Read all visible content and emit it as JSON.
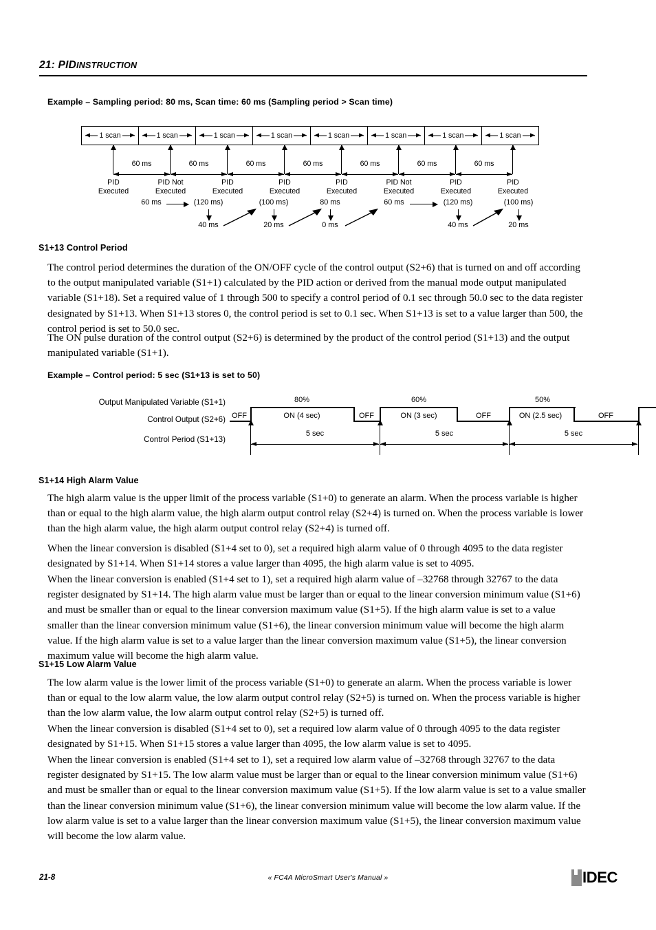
{
  "header": {
    "chapter_number": "21:",
    "chapter_title_first": "PID",
    "chapter_title_rest": "INSTRUCTION"
  },
  "example1": {
    "heading": "Example – Sampling period: 80 ms, Scan time: 60 ms (Sampling period > Scan time)",
    "scan_label": "1 scan",
    "scan_count": 8,
    "interval_label": "60 ms",
    "interval_count": 7,
    "pid_labels": [
      "PID\nExecuted",
      "PID Not\nExecuted",
      "PID\nExecuted",
      "PID\nExecuted",
      "PID\nExecuted",
      "PID Not\nExecuted",
      "PID\nExecuted",
      "PID\nExecuted"
    ],
    "flow": [
      {
        "top": "60 ms",
        "bottom": ""
      },
      {
        "top": "(120 ms)",
        "bottom": "40 ms"
      },
      {
        "top": "(100 ms)",
        "bottom": "20 ms"
      },
      {
        "top": "80 ms",
        "bottom": "0 ms"
      },
      {
        "top": "60 ms",
        "bottom": ""
      },
      {
        "top": "(120 ms)",
        "bottom": "40 ms"
      },
      {
        "top": "(100 ms)",
        "bottom": "20 ms"
      }
    ]
  },
  "s1_13": {
    "heading": "S1+13  Control Period",
    "p1": "The control period determines the duration of the ON/OFF cycle of the control output (S2+6) that is turned on and off according to the output manipulated variable (S1+1) calculated by the PID action or derived from the manual mode output manipulated variable (S1+18). Set a required value of 1 through 500 to specify a control period of 0.1 sec through 50.0 sec to the data register designated by S1+13. When S1+13 stores 0, the control period is set to 0.1 sec. When S1+13 is set to a value larger than 500, the control period is set to 50.0 sec.",
    "p2": "The ON pulse duration of the control output (S2+6) is determined by the product of the control period (S1+13) and the output manipulated variable (S1+1)."
  },
  "example2": {
    "heading": "Example – Control period: 5 sec (S1+13 is set to 50)",
    "row_labels": [
      "Output Manipulated Variable (S1+1)",
      "Control Output (S2+6)",
      "Control Period (S1+13)"
    ],
    "off_label": "OFF",
    "period_label": "5 sec",
    "cycles": [
      {
        "percent": "80%",
        "on_label": "ON (4 sec)",
        "period": "5 sec"
      },
      {
        "percent": "60%",
        "on_label": "ON (3 sec)",
        "period": "5 sec"
      },
      {
        "percent": "50%",
        "on_label": "ON (2.5 sec)",
        "period": "5 sec"
      }
    ]
  },
  "s1_14": {
    "heading": "S1+14  High Alarm Value",
    "p1": "The high alarm value is the upper limit of the process variable (S1+0) to generate an alarm. When the process variable is higher than or equal to the high alarm value, the high alarm output control relay (S2+4) is turned on. When the process variable is lower than the high alarm value, the high alarm output control relay (S2+4) is turned off.",
    "p2": "When the linear conversion is disabled (S1+4 set to 0), set a required high alarm value of 0 through 4095 to the data register designated by S1+14. When S1+14 stores a value larger than 4095, the high alarm value is set to 4095.",
    "p3": "When the linear conversion is enabled (S1+4 set to 1), set a required high alarm value of –32768 through 32767 to the data register designated by S1+14. The high alarm value must be larger than or equal to the linear conversion minimum value (S1+6) and must be smaller than or equal to the linear conversion maximum value (S1+5). If the high alarm value is set to a value smaller than the linear conversion minimum value (S1+6), the linear conversion minimum value will become the high alarm value. If the high alarm value is set to a value larger than the linear conversion maximum value (S1+5), the linear conversion maximum value will become the high alarm value."
  },
  "s1_15": {
    "heading": "S1+15  Low Alarm Value",
    "p1": "The low alarm value is the lower limit of the process variable (S1+0) to generate an alarm. When the process variable is lower than or equal to the low alarm value, the low alarm output control relay (S2+5) is turned on. When the process variable is higher than the low alarm value, the low alarm output control relay (S2+5) is turned off.",
    "p2": "When the linear conversion is disabled (S1+4 set to 0), set a required low alarm value of 0 through 4095 to the data register designated by S1+15. When S1+15 stores a value larger than 4095, the low alarm value is set to 4095.",
    "p3": "When the linear conversion is enabled (S1+4 set to 1), set a required low alarm value of –32768 through 32767 to the data register designated by S1+15. The low alarm value must be larger than or equal to the linear conversion minimum value (S1+6) and must be smaller than or equal to the linear conversion maximum value (S1+5). If the low alarm value is set to a value smaller than the linear conversion minimum value (S1+6), the linear conversion minimum value will become the low alarm value. If the low alarm value is set to a value larger than the linear conversion maximum value (S1+5), the linear conversion maximum value will become the low alarm value."
  },
  "footer": {
    "page_number": "21-8",
    "manual_open": "«",
    "manual_f": "FC4A M",
    "manual_sc1": "ICRO",
    "manual_s": "S",
    "manual_sc2": "MART",
    "manual_u": " U",
    "manual_sc3": "SER",
    "manual_apos": "'",
    "manual_s2": "S M",
    "manual_sc4": "ANUAL",
    "manual_close": "»",
    "manual_full": "« FC4A MicroSmart User's Manual »",
    "logo_text": "IDEC"
  }
}
